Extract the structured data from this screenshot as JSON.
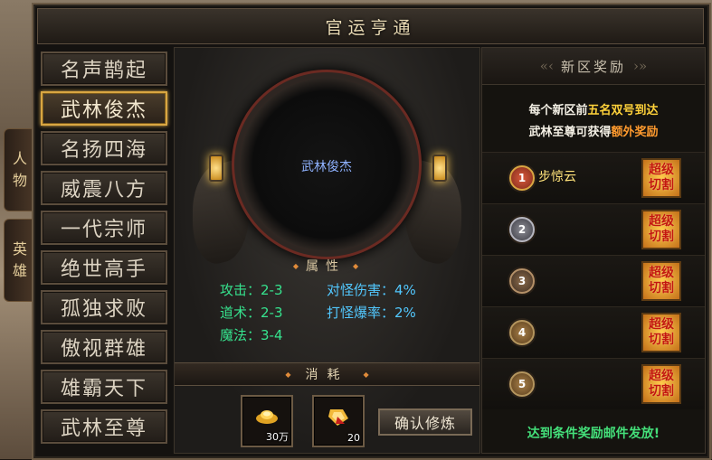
{
  "side_tabs": [
    {
      "label_top": "人",
      "label_bottom": "物"
    },
    {
      "label_top": "英",
      "label_bottom": "雄"
    }
  ],
  "window": {
    "title": "官运亨通"
  },
  "ranks": [
    "名声鹊起",
    "武林俊杰",
    "名扬四海",
    "威震八方",
    "一代宗师",
    "绝世高手",
    "孤独求败",
    "傲视群雄",
    "雄霸天下",
    "武林至尊"
  ],
  "selected_rank": "武林俊杰",
  "center": {
    "medallion_name": "武林俊杰",
    "attr_title": "属性",
    "attrs": {
      "attack": "攻击：2-3",
      "taoism": "道术：2-3",
      "magic": "魔法：3-4",
      "monster_damage": "对怪伤害：4%",
      "monster_crit": "打怪爆率：2%"
    },
    "consume_title": "消耗",
    "costs": [
      {
        "icon": "gold-ingot-icon",
        "qty": "30万"
      },
      {
        "icon": "gem-arrow-icon",
        "qty": "20"
      }
    ],
    "confirm_label": "确认修炼"
  },
  "reward": {
    "title": "新区奖励",
    "desc_line1_a": "每个新区前",
    "desc_line1_b": "五名双号到达",
    "desc_line2_a": "武林至尊可获得",
    "desc_line2_b": "额外奖励",
    "rows": [
      {
        "rank": "1",
        "name": "步惊云",
        "badge_line1": "超级",
        "badge_line2": "切割"
      },
      {
        "rank": "2",
        "name": "",
        "badge_line1": "超级",
        "badge_line2": "切割"
      },
      {
        "rank": "3",
        "name": "",
        "badge_line1": "超级",
        "badge_line2": "切割"
      },
      {
        "rank": "4",
        "name": "",
        "badge_line1": "超级",
        "badge_line2": "切割"
      },
      {
        "rank": "5",
        "name": "",
        "badge_line1": "超级",
        "badge_line2": "切割"
      }
    ],
    "footer": "达到条件奖励邮件发放!"
  }
}
